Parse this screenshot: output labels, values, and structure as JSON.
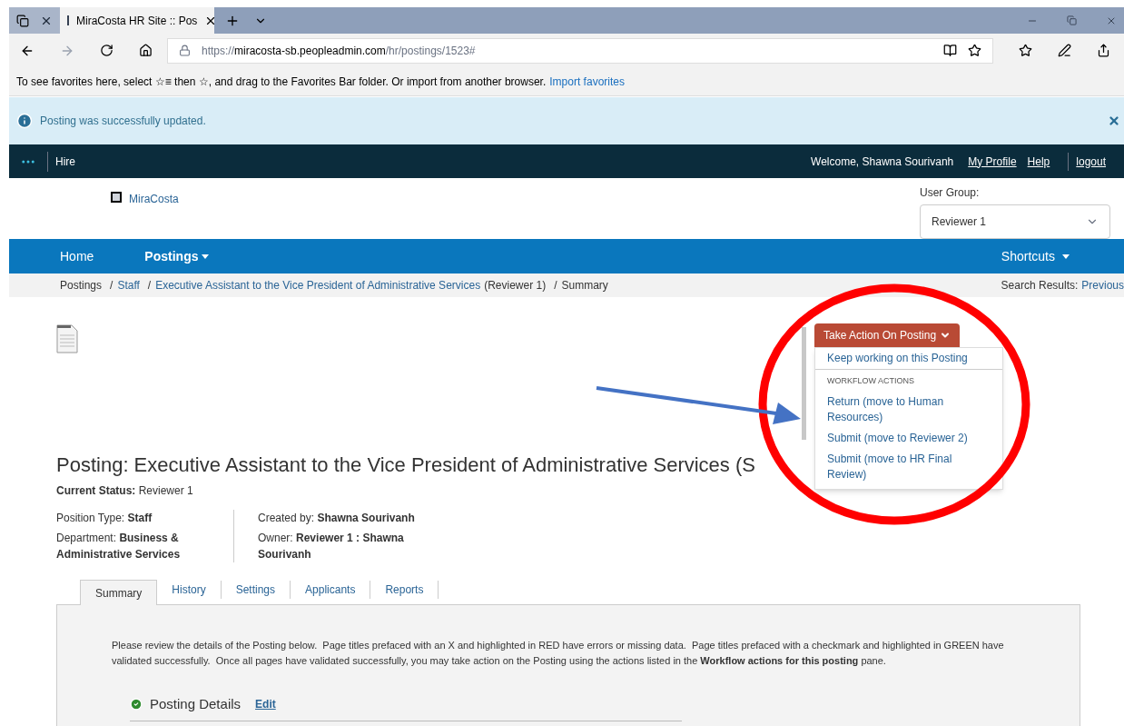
{
  "browser": {
    "tabs": [
      {
        "title": "MiraCosta HR Site :: Pos",
        "selected": true
      }
    ],
    "url": {
      "scheme": "https://",
      "host": "miracosta-sb.peopleadmin.com",
      "path": "/hr/postings/1523#"
    },
    "favorites_bar": {
      "text": "To see favorites here, select ☆≡ then ☆, and drag to the Favorites Bar folder. Or import from another browser.",
      "link": "Import favorites"
    }
  },
  "alert": {
    "message": "Posting was successfully updated."
  },
  "top_nav": {
    "app": "Hire",
    "welcome": "Welcome, Shawna Sourivanh",
    "links": [
      "My Profile",
      "Help",
      "logout"
    ]
  },
  "header": {
    "logo": "MiraCosta",
    "user_group_label": "User Group:",
    "user_group_value": "Reviewer 1"
  },
  "main_nav": {
    "left": [
      {
        "label": "Home",
        "dropdown": false
      },
      {
        "label": "Postings",
        "dropdown": true
      }
    ],
    "right": [
      {
        "label": "Shortcuts",
        "dropdown": true
      }
    ]
  },
  "breadcrumb": [
    {
      "text": "Postings",
      "kind": "text"
    },
    {
      "text": "/",
      "kind": "separator"
    },
    {
      "text": "Staff",
      "kind": "link"
    },
    {
      "text": "/",
      "kind": "separator"
    },
    {
      "text": "Executive Assistant to the Vice President of Administrative Services",
      "kind": "link"
    },
    {
      "text": "(Reviewer 1)",
      "kind": "text"
    },
    {
      "text": "/",
      "kind": "separator"
    },
    {
      "text": "Summary",
      "kind": "text"
    }
  ],
  "search_results": {
    "label": "Search Results:",
    "link": "Previous"
  },
  "posting": {
    "title": "Posting: Executive Assistant to the Vice President of Administrative Services (S",
    "status_label": "Current Status:",
    "status": "Reviewer 1",
    "left_fields": [
      {
        "label": "Position Type:",
        "value": "Staff"
      },
      {
        "label": "Department:",
        "value": "Business & Administrative Services"
      }
    ],
    "right_fields": [
      {
        "label": "Created by:",
        "value": "Shawna Sourivanh"
      },
      {
        "label": "Owner:",
        "value": "Reviewer 1 : Shawna Sourivanh"
      }
    ]
  },
  "action_menu": {
    "button": "Take Action On Posting",
    "expanded": true,
    "items": [
      {
        "kind": "item",
        "text": "Keep working on this Posting"
      },
      {
        "kind": "header",
        "text": "WORKFLOW ACTIONS"
      },
      {
        "kind": "item",
        "text": "Return (move to Human Resources)"
      },
      {
        "kind": "item",
        "text": "Submit (move to Reviewer 2)"
      },
      {
        "kind": "item",
        "text": "Submit (move to HR Final Review)"
      }
    ]
  },
  "tabs": [
    {
      "label": "Summary",
      "selected": true
    },
    {
      "label": "History",
      "selected": false
    },
    {
      "label": "Settings",
      "selected": false
    },
    {
      "label": "Applicants",
      "selected": false
    },
    {
      "label": "Reports",
      "selected": false
    }
  ],
  "summary": {
    "instructions": "Please review the details of the Posting below.  Page titles prefaced with an X and highlighted in RED have errors or missing data.  Page titles prefaced with a checkmark and highlighted in GREEN have validated successfully.  Once all pages have validated successfully, you may take action on the Posting using the actions listed in the **Workflow actions for this posting** pane.",
    "section": {
      "title": "Posting Details",
      "valid": true,
      "edit": "Edit"
    }
  }
}
